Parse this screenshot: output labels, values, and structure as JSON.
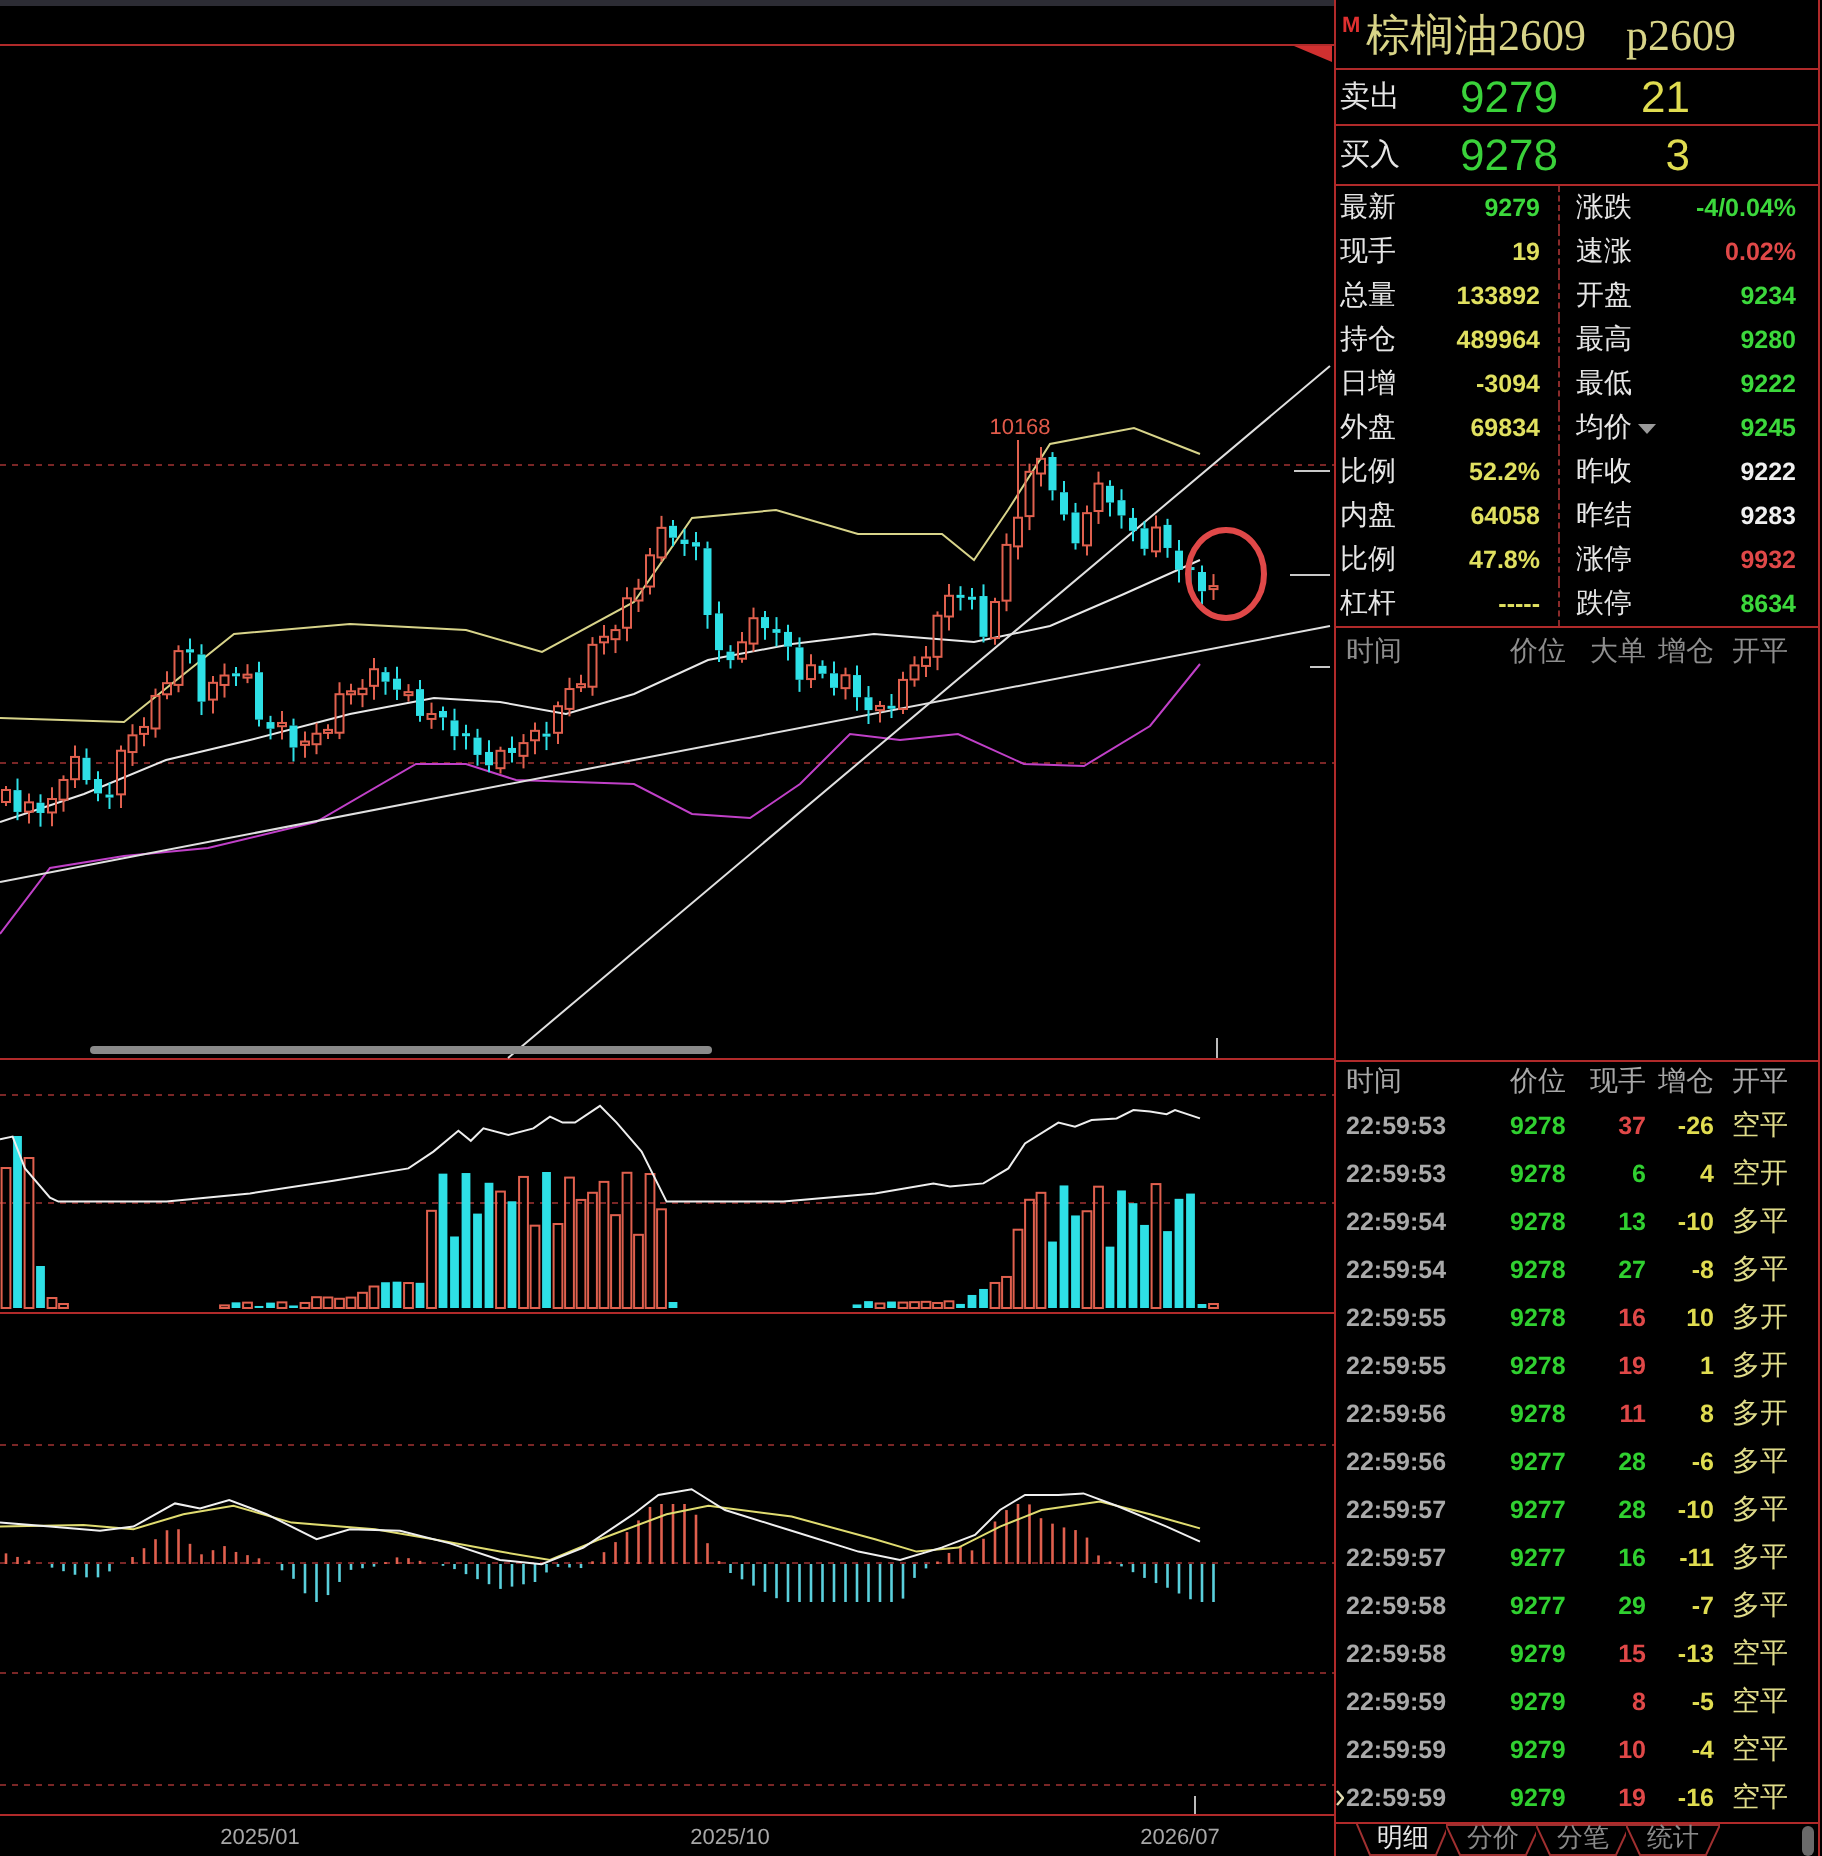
{
  "quote": {
    "badge": "M",
    "name": "棕榈油2609",
    "code": "p2609"
  },
  "book": [
    {
      "label": "卖出",
      "price": "9279",
      "volume": "21"
    },
    {
      "label": "买入",
      "price": "9278",
      "volume": "3"
    }
  ],
  "stats": [
    {
      "left": {
        "label": "最新",
        "value": "9279",
        "color": "#3cd83c"
      },
      "right": {
        "label": "涨跌",
        "value": "-4/0.04%",
        "color": "#3cd83c"
      }
    },
    {
      "left": {
        "label": "现手",
        "value": "19",
        "color": "#e0e060"
      },
      "right": {
        "label": "速涨",
        "value": "0.02%",
        "color": "#e04848"
      }
    },
    {
      "left": {
        "label": "总量",
        "value": "133892",
        "color": "#e0e060"
      },
      "right": {
        "label": "开盘",
        "value": "9234",
        "color": "#3cd83c"
      }
    },
    {
      "left": {
        "label": "持仓",
        "value": "489964",
        "color": "#e0e060"
      },
      "right": {
        "label": "最高",
        "value": "9280",
        "color": "#3cd83c"
      }
    },
    {
      "left": {
        "label": "日增",
        "value": "-3094",
        "color": "#e0e060"
      },
      "right": {
        "label": "最低",
        "value": "9222",
        "color": "#3cd83c"
      }
    },
    {
      "left": {
        "label": "外盘",
        "value": "69834",
        "color": "#e0e060"
      },
      "right": {
        "label": "均价",
        "value": "9245",
        "color": "#3cd83c",
        "dropdown": true
      }
    },
    {
      "left": {
        "label": "比例",
        "value": "52.2%",
        "color": "#e0e060"
      },
      "right": {
        "label": "昨收",
        "value": "9222",
        "color": "#f0f0f0"
      }
    },
    {
      "left": {
        "label": "内盘",
        "value": "64058",
        "color": "#e0e060"
      },
      "right": {
        "label": "昨结",
        "value": "9283",
        "color": "#f0f0f0"
      }
    },
    {
      "left": {
        "label": "比例",
        "value": "47.8%",
        "color": "#e0e060"
      },
      "right": {
        "label": "涨停",
        "value": "9932",
        "color": "#e04848"
      }
    },
    {
      "left": {
        "label": "杠杆",
        "value": "-----",
        "color": "#e0e060"
      },
      "right": {
        "label": "跌停",
        "value": "8634",
        "color": "#3cd83c"
      }
    }
  ],
  "big_orders": {
    "columns": [
      "时间",
      "价位",
      "大单",
      "增仓",
      "开平"
    ]
  },
  "ticks": {
    "columns": [
      "时间",
      "价位",
      "现手",
      "增仓",
      "开平"
    ],
    "rows": [
      {
        "time": "22:59:53",
        "price": "9278",
        "volume": "37",
        "color": "#e04848",
        "change": "-26",
        "type": "空平",
        "selected": false
      },
      {
        "time": "22:59:53",
        "price": "9278",
        "volume": "6",
        "color": "#30d030",
        "change": "4",
        "type": "空开",
        "selected": false
      },
      {
        "time": "22:59:54",
        "price": "9278",
        "volume": "13",
        "color": "#30d030",
        "change": "-10",
        "type": "多平",
        "selected": false
      },
      {
        "time": "22:59:54",
        "price": "9278",
        "volume": "27",
        "color": "#30d030",
        "change": "-8",
        "type": "多平",
        "selected": false
      },
      {
        "time": "22:59:55",
        "price": "9278",
        "volume": "16",
        "color": "#e04848",
        "change": "10",
        "type": "多开",
        "selected": false
      },
      {
        "time": "22:59:55",
        "price": "9278",
        "volume": "19",
        "color": "#e04848",
        "change": "1",
        "type": "多开",
        "selected": false
      },
      {
        "time": "22:59:56",
        "price": "9278",
        "volume": "11",
        "color": "#e04848",
        "change": "8",
        "type": "多开",
        "selected": false
      },
      {
        "time": "22:59:56",
        "price": "9277",
        "volume": "28",
        "color": "#30d030",
        "change": "-6",
        "type": "多平",
        "selected": false
      },
      {
        "time": "22:59:57",
        "price": "9277",
        "volume": "28",
        "color": "#30d030",
        "change": "-10",
        "type": "多平",
        "selected": false
      },
      {
        "time": "22:59:57",
        "price": "9277",
        "volume": "16",
        "color": "#30d030",
        "change": "-11",
        "type": "多平",
        "selected": false
      },
      {
        "time": "22:59:58",
        "price": "9277",
        "volume": "29",
        "color": "#30d030",
        "change": "-7",
        "type": "多平",
        "selected": false
      },
      {
        "time": "22:59:58",
        "price": "9279",
        "volume": "15",
        "color": "#e04848",
        "change": "-13",
        "type": "空平",
        "selected": false
      },
      {
        "time": "22:59:59",
        "price": "9279",
        "volume": "8",
        "color": "#e04848",
        "change": "-5",
        "type": "空平",
        "selected": false
      },
      {
        "time": "22:59:59",
        "price": "9279",
        "volume": "10",
        "color": "#e04848",
        "change": "-4",
        "type": "空平",
        "selected": false
      },
      {
        "time": "22:59:59",
        "price": "9279",
        "volume": "19",
        "color": "#e04848",
        "change": "-16",
        "type": "空平",
        "selected": true
      }
    ]
  },
  "tabs": [
    {
      "label": "明细",
      "selected": true
    },
    {
      "label": "分价",
      "selected": false
    },
    {
      "label": "分笔",
      "selected": false
    },
    {
      "label": "统计",
      "selected": false
    }
  ],
  "chart": {
    "peak_label": "10168",
    "dates": [
      "2025/01",
      "2025/10",
      "2026/07"
    ]
  }
}
